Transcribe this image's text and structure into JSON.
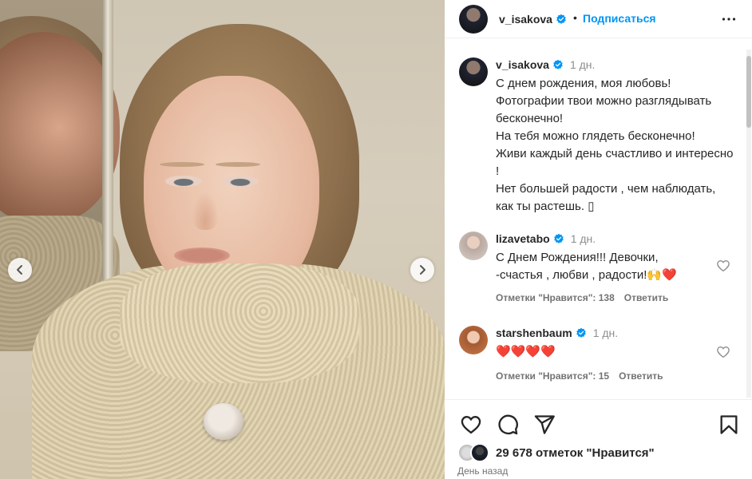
{
  "post": {
    "author": "v_isakova",
    "follow_label": "Подписаться",
    "separator": "•"
  },
  "caption": {
    "username": "v_isakova",
    "time": "1 дн.",
    "text": "С днем рождения, моя любовь!\nФотографии твои можно разглядывать бесконечно!\nНа тебя можно глядеть бесконечно!\nЖиви каждый день счастливо и интересно !\nНет большей радости , чем наблюдать, как ты растешь. ▯"
  },
  "comments": [
    {
      "username": "lizavetabo",
      "time": "1 дн.",
      "text": "С Днем Рождения!!! Девочки,\n-счастья , любви , радости!🙌❤️",
      "likes_label": "Отметки \"Нравится\": 138",
      "reply_label": "Ответить"
    },
    {
      "username": "starshenbaum",
      "time": "1 дн.",
      "text": "❤️❤️❤️❤️",
      "likes_label": "Отметки \"Нравится\": 15",
      "reply_label": "Ответить"
    }
  ],
  "footer": {
    "likes": "29 678 отметок \"Нравится\"",
    "date": "День назад"
  },
  "icons": {
    "verified": "verified-badge-icon",
    "more": "more-options-icon",
    "like": "heart-icon",
    "comment": "comment-icon",
    "share": "share-icon",
    "save": "bookmark-icon",
    "prev": "chevron-left-icon",
    "next": "chevron-right-icon"
  },
  "colors": {
    "accent": "#0095f6",
    "verified": "#0095f6",
    "text": "#262626",
    "muted": "#737373"
  }
}
